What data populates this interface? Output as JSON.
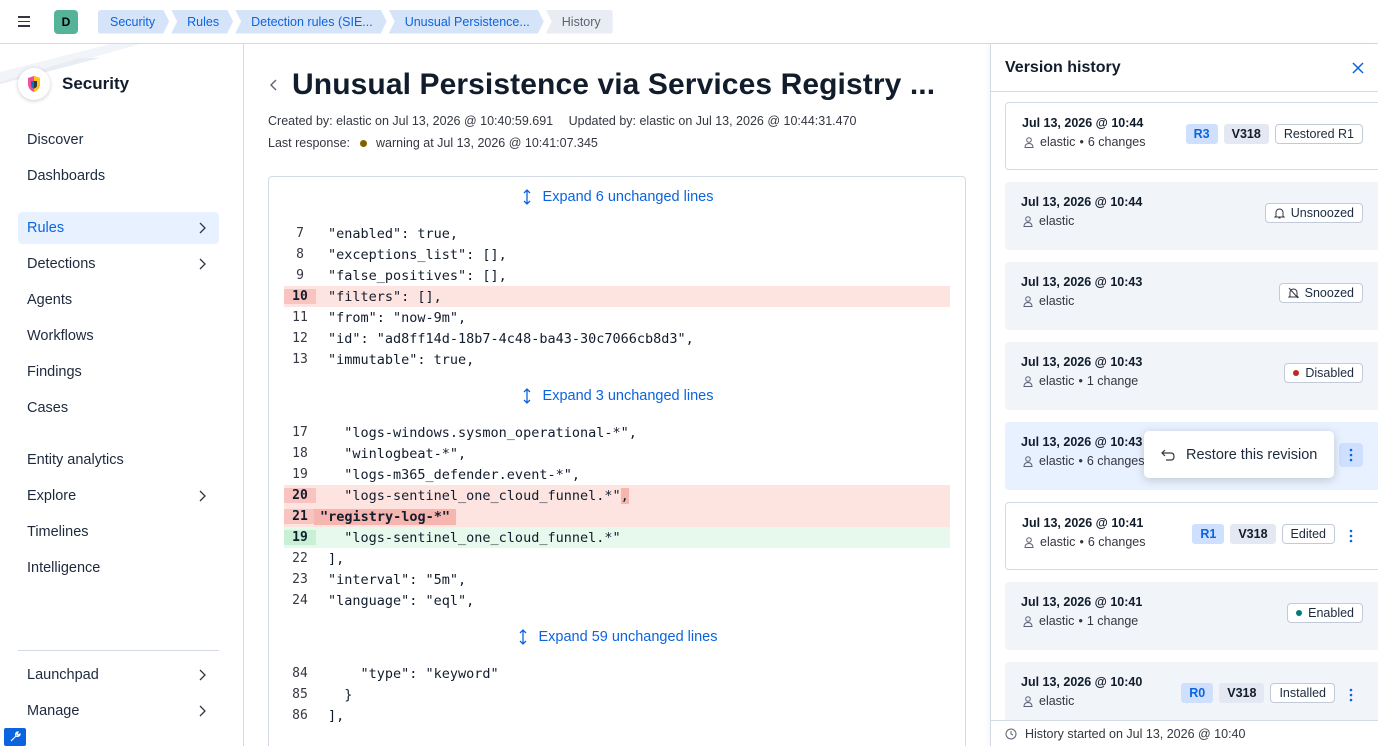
{
  "topbar": {
    "space_initial": "D",
    "breadcrumbs": [
      "Security",
      "Rules",
      "Detection rules (SIE...",
      "Unusual Persistence...",
      "History"
    ]
  },
  "sidebar": {
    "brand": "Security",
    "items": [
      {
        "label": "Discover",
        "chevron": false
      },
      {
        "label": "Dashboards",
        "chevron": false
      },
      {
        "label": "Rules",
        "chevron": true,
        "active": true
      },
      {
        "label": "Detections",
        "chevron": true
      },
      {
        "label": "Agents",
        "chevron": false
      },
      {
        "label": "Workflows",
        "chevron": false
      },
      {
        "label": "Findings",
        "chevron": false
      },
      {
        "label": "Cases",
        "chevron": false
      },
      {
        "label": "Entity analytics",
        "chevron": false
      },
      {
        "label": "Explore",
        "chevron": true
      },
      {
        "label": "Timelines",
        "chevron": false
      },
      {
        "label": "Intelligence",
        "chevron": false
      }
    ],
    "bottom": [
      {
        "label": "Launchpad",
        "chevron": true
      },
      {
        "label": "Manage",
        "chevron": true
      }
    ]
  },
  "main": {
    "title": "Unusual Persistence via Services Registry ...",
    "created": "Created by: elastic on Jul 13, 2026 @ 10:40:59.691",
    "updated": "Updated by: elastic on Jul 13, 2026 @ 10:44:31.470",
    "last_response_label": "Last response:",
    "last_response_value": "warning at Jul 13, 2026 @ 10:41:07.345",
    "diff": {
      "expand_1": "Expand 6 unchanged lines",
      "block_1": [
        {
          "n": "7",
          "t": "\"enabled\": true,"
        },
        {
          "n": "8",
          "t": "\"exceptions_list\": [],"
        },
        {
          "n": "9",
          "t": "\"false_positives\": [],"
        },
        {
          "n": "10",
          "t": "\"filters\": [],",
          "type": "del"
        },
        {
          "n": "11",
          "t": "\"from\": \"now-9m\","
        },
        {
          "n": "12",
          "t": "\"id\": \"ad8ff14d-18b7-4c48-ba43-30c7066cb8d3\","
        },
        {
          "n": "13",
          "t": "\"immutable\": true,"
        }
      ],
      "expand_2": "Expand 3 unchanged lines",
      "block_2": [
        {
          "n": "17",
          "t": "  \"logs-windows.sysmon_operational-*\","
        },
        {
          "n": "18",
          "t": "  \"winlogbeat-*\","
        },
        {
          "n": "19",
          "t": "  \"logs-m365_defender.event-*\","
        },
        {
          "n": "20",
          "t": "  \"logs-sentinel_one_cloud_funnel.*\"",
          "extra": ",",
          "type": "del"
        },
        {
          "n": "21",
          "t": "\"registry-log-*\"",
          "type": "del-strong"
        },
        {
          "n": "19",
          "t": "  \"logs-sentinel_one_cloud_funnel.*\"",
          "type": "add"
        },
        {
          "n": "22",
          "t": "],"
        },
        {
          "n": "23",
          "t": "\"interval\": \"5m\","
        },
        {
          "n": "24",
          "t": "\"language\": \"eql\","
        }
      ],
      "expand_3": "Expand 59 unchanged lines",
      "block_3": [
        {
          "n": "84",
          "t": "    \"type\": \"keyword\""
        },
        {
          "n": "85",
          "t": "  }"
        },
        {
          "n": "86",
          "t": "],"
        }
      ]
    }
  },
  "flyout": {
    "title": "Version history",
    "revisions": [
      {
        "date": "Jul 13, 2026 @ 10:44",
        "user": "elastic",
        "changes": "6 changes",
        "rev": "R3",
        "version": "V318",
        "label": "Restored R1"
      },
      {
        "date": "Jul 13, 2026 @ 10:44",
        "user": "elastic",
        "status": "Unsnoozed"
      },
      {
        "date": "Jul 13, 2026 @ 10:43",
        "user": "elastic",
        "status": "Snoozed"
      },
      {
        "date": "Jul 13, 2026 @ 10:43",
        "user": "elastic",
        "changes": "1 change",
        "status": "Disabled"
      },
      {
        "date": "Jul 13, 2026 @ 10:43",
        "user": "elastic",
        "changes": "6 changes"
      },
      {
        "date": "Jul 13, 2026 @ 10:41",
        "user": "elastic",
        "changes": "6 changes",
        "rev": "R1",
        "version": "V318",
        "label": "Edited"
      },
      {
        "date": "Jul 13, 2026 @ 10:41",
        "user": "elastic",
        "changes": "1 change",
        "status": "Enabled"
      },
      {
        "date": "Jul 13, 2026 @ 10:40",
        "user": "elastic",
        "rev": "R0",
        "version": "V318",
        "label": "Installed"
      }
    ],
    "separator": "•",
    "popover_label": "Restore this revision",
    "footer": "History started on Jul 13, 2026 @ 10:40"
  },
  "colors": {
    "accent": "#0b64dd",
    "deleted_bg": "#fde4e1",
    "added_bg": "#e6f9ec",
    "disabled_dot": "#bd271e",
    "enabled_dot": "#017d73",
    "warning_dot": "#826000"
  }
}
